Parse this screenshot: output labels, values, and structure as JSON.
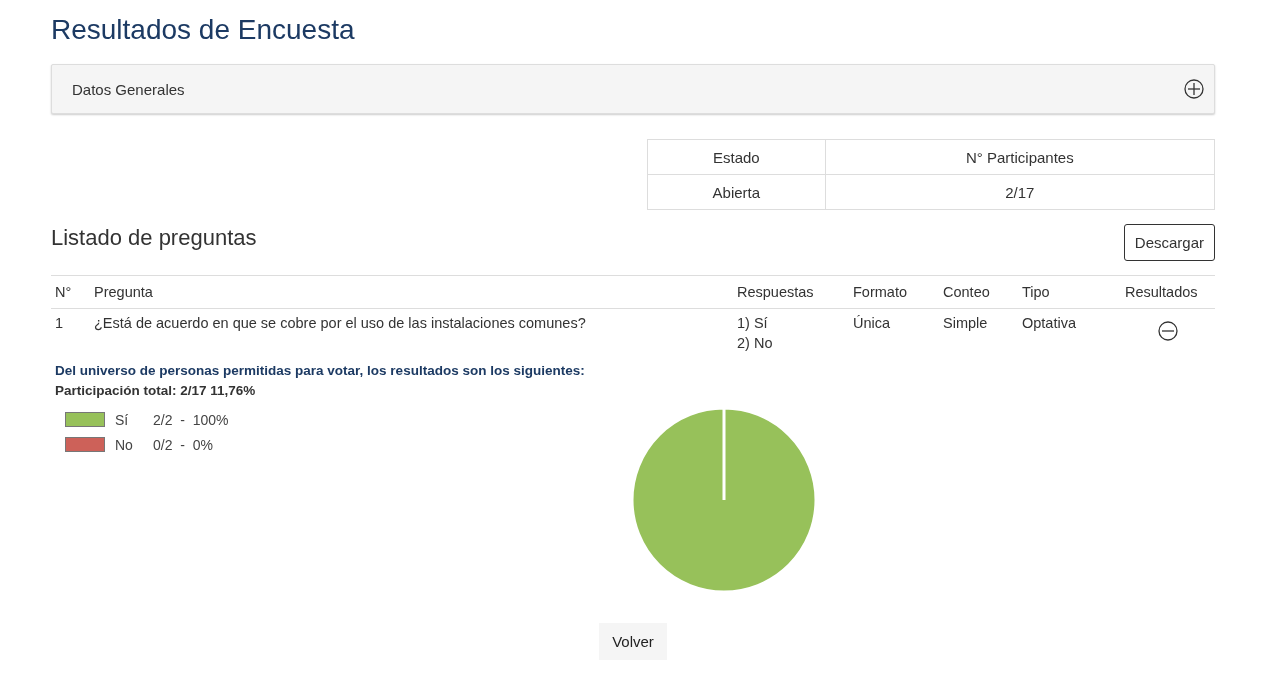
{
  "page": {
    "title": "Resultados de Encuesta"
  },
  "general_panel": {
    "title": "Datos Generales",
    "expanded": false
  },
  "status_table": {
    "columns": [
      "Estado",
      "N° Participantes"
    ],
    "rows": [
      [
        "Abierta",
        "2/17"
      ]
    ]
  },
  "questions": {
    "title": "Listado de preguntas",
    "download_button": "Descargar",
    "columns": [
      "N°",
      "Pregunta",
      "Respuestas",
      "Formato",
      "Conteo",
      "Tipo",
      "Resultados"
    ],
    "rows": [
      {
        "number": "1",
        "question": "¿Está de acuerdo en que se cobre por el uso de las instalaciones comunes?",
        "answers": [
          "1) Sí",
          "2) No"
        ],
        "format": "Única",
        "count": "Simple",
        "type": "Optativa",
        "expanded": true
      }
    ]
  },
  "results": {
    "intro": "Del universo de personas permitidas para votar, los resultados son los siguientes:",
    "participation": "Participación total: 2/17 11,76%",
    "legend": [
      {
        "detail": "2/2  -  100%",
        "color": "#97c15a"
      },
      {
        "detail": "0/2  -  0%",
        "color": "#cd6159"
      }
    ],
    "chart_data": {
      "type": "pie",
      "categories": [
        "Sí",
        "No"
      ],
      "values": [
        100,
        0
      ]
    }
  },
  "back_button": "Volver"
}
